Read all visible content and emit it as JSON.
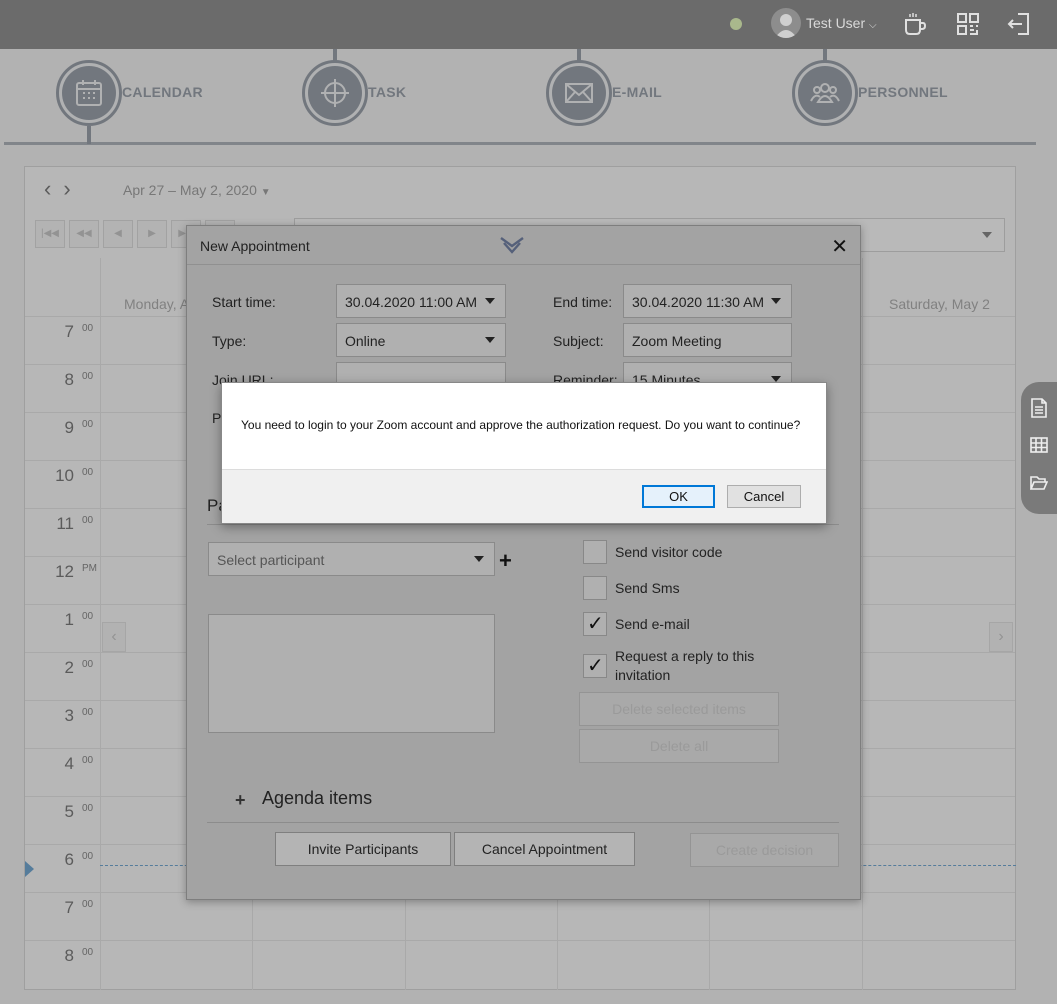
{
  "topbar": {
    "user_name": "Test User",
    "icons": [
      "status-dot",
      "user-icon",
      "coffee-icon",
      "qr-code-icon",
      "logout-icon"
    ]
  },
  "modules": [
    {
      "label": "CALENDAR",
      "icon": "calendar-icon"
    },
    {
      "label": "TASK",
      "icon": "crosshair-icon"
    },
    {
      "label": "E-MAIL",
      "icon": "envelope-icon"
    },
    {
      "label": "PERSONNEL",
      "icon": "people-icon"
    }
  ],
  "calendar": {
    "date_range": "Apr 27 – May 2, 2020",
    "day_headers": [
      "Monday, A",
      "Saturday, May 2"
    ],
    "hours": [
      {
        "h": "7",
        "s": "00"
      },
      {
        "h": "8",
        "s": "00"
      },
      {
        "h": "9",
        "s": "00"
      },
      {
        "h": "10",
        "s": "00"
      },
      {
        "h": "11",
        "s": "00"
      },
      {
        "h": "12",
        "s": "PM"
      },
      {
        "h": "1",
        "s": "00"
      },
      {
        "h": "2",
        "s": "00"
      },
      {
        "h": "3",
        "s": "00"
      },
      {
        "h": "4",
        "s": "00"
      },
      {
        "h": "5",
        "s": "00"
      },
      {
        "h": "6",
        "s": "00"
      },
      {
        "h": "7",
        "s": "00"
      },
      {
        "h": "8",
        "s": "00"
      }
    ]
  },
  "side_tools": [
    "document-icon",
    "table-icon",
    "folder-open-icon"
  ],
  "dialog": {
    "title": "New Appointment",
    "start_time_label": "Start time:",
    "start_time_value": "30.04.2020 11:00 AM",
    "end_time_label": "End time:",
    "end_time_value": "30.04.2020 11:30 AM",
    "type_label": "Type:",
    "type_value": "Online",
    "subject_label": "Subject:",
    "subject_value": "Zoom Meeting",
    "join_url_label": "Join URL:",
    "reminder_label": "Reminder:",
    "reminder_value": "15 Minutes",
    "section_head": "Pa",
    "p_label": "P",
    "participant_placeholder": "Select participant",
    "send_visitor_code": "Send visitor code",
    "send_sms": "Send Sms",
    "send_email": "Send e-mail",
    "request_reply_1": "Request a reply to this",
    "request_reply_2": "invitation",
    "delete_selected": "Delete selected items",
    "delete_all": "Delete all",
    "agenda_items": "Agenda items",
    "invite_participants": "Invite Participants",
    "cancel_appointment": "Cancel Appointment",
    "create_decision": "Create decision"
  },
  "confirm": {
    "message": "You need to login to your Zoom account and approve the authorization request. Do you want to continue?",
    "ok_label": "OK",
    "cancel_label": "Cancel"
  }
}
